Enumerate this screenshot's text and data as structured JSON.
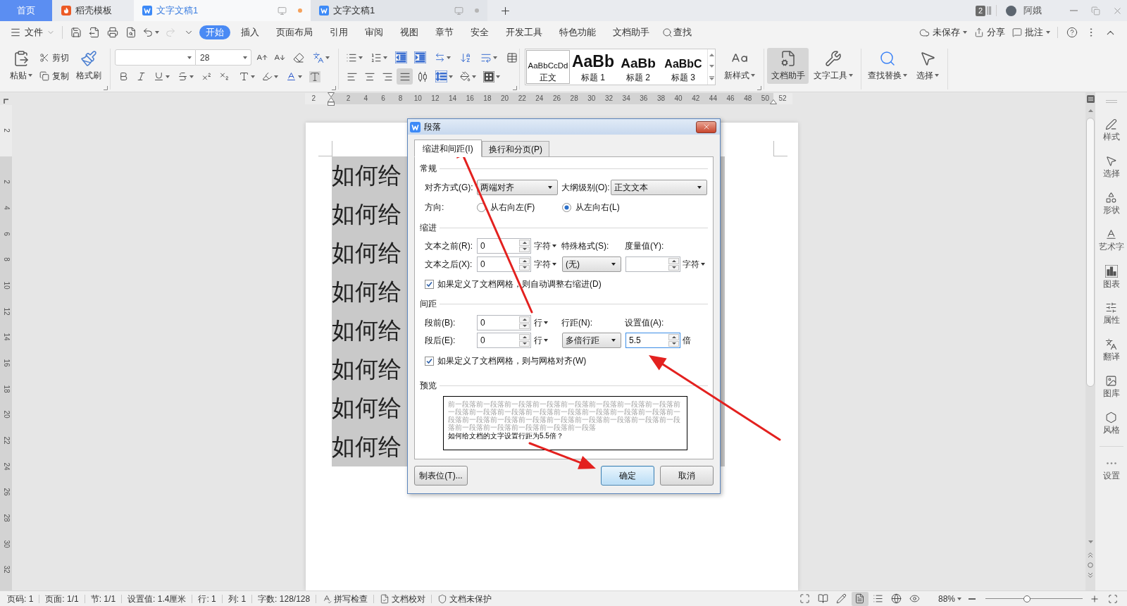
{
  "tab_bar": {
    "tabs": [
      {
        "label": "首页",
        "kind": "home",
        "selected": false
      },
      {
        "label": "稻壳模板",
        "kind": "template",
        "selected": false
      },
      {
        "label": "文字文稿1",
        "kind": "document",
        "selected": true
      },
      {
        "label": "文字文稿1",
        "kind": "document",
        "selected": false
      }
    ],
    "badge": "2",
    "user_name": "阿娥"
  },
  "menu_bar": {
    "file_menu": "文件",
    "quick_access": [
      {
        "kind": "save",
        "disabled": false
      },
      {
        "kind": "export",
        "disabled": false
      },
      {
        "kind": "print",
        "disabled": false
      },
      {
        "kind": "preview",
        "disabled": false
      },
      {
        "kind": "undo",
        "disabled": false
      },
      {
        "kind": "redo",
        "disabled": true
      },
      {
        "kind": "customize",
        "disabled": false
      }
    ],
    "tabs": [
      {
        "label": "开始",
        "selected": true
      },
      {
        "label": "插入",
        "selected": false
      },
      {
        "label": "页面布局",
        "selected": false
      },
      {
        "label": "引用",
        "selected": false
      },
      {
        "label": "审阅",
        "selected": false
      },
      {
        "label": "视图",
        "selected": false
      },
      {
        "label": "章节",
        "selected": false
      },
      {
        "label": "安全",
        "selected": false
      },
      {
        "label": "开发工具",
        "selected": false
      },
      {
        "label": "特色功能",
        "selected": false
      },
      {
        "label": "文档助手",
        "selected": false
      }
    ],
    "search": "查找",
    "actions": [
      {
        "label": "未保存",
        "kind": "cloud"
      },
      {
        "label": "分享",
        "kind": "share"
      },
      {
        "label": "批注",
        "kind": "comment"
      }
    ]
  },
  "toolbar": {
    "clipboard": {
      "paste": "粘贴",
      "cut": "剪切",
      "copy": "复制",
      "format_painter": "格式刷"
    },
    "font_size": "28",
    "alignment": [
      {
        "kind": "left",
        "selected": false
      },
      {
        "kind": "center",
        "selected": false
      },
      {
        "kind": "right",
        "selected": false
      },
      {
        "kind": "justify",
        "selected": true
      },
      {
        "kind": "distributed",
        "selected": false
      }
    ],
    "styles": [
      {
        "sample": "AaBbCcDd",
        "label": "正文",
        "kind": "body",
        "selected": true
      },
      {
        "sample": "AaBb",
        "label": "标题 1",
        "kind": "heading1",
        "selected": false
      },
      {
        "sample": "AaBb",
        "label": "标题 2",
        "kind": "heading2",
        "selected": false
      },
      {
        "sample": "AaBbC",
        "label": "标题 3",
        "kind": "heading3",
        "selected": false
      }
    ],
    "new_style": "新样式",
    "tools": [
      {
        "label": "文档助手",
        "kind": "assistant",
        "selected": true
      },
      {
        "label": "文字工具",
        "kind": "text_tools",
        "selected": false
      }
    ],
    "find": [
      {
        "label": "查找替换",
        "kind": "find"
      },
      {
        "label": "选择",
        "kind": "select"
      }
    ]
  },
  "horizontal_ruler": {
    "left_label": "2",
    "labels": [
      "2",
      "4",
      "6",
      "8",
      "10",
      "12",
      "14",
      "16",
      "18",
      "20",
      "22",
      "24",
      "26",
      "28",
      "30",
      "32",
      "34",
      "36",
      "38",
      "40",
      "42",
      "44",
      "46",
      "48",
      "50",
      "52"
    ]
  },
  "vertical_ruler": {
    "top_label": "2",
    "labels": [
      "2",
      "4",
      "6",
      "8",
      "10",
      "12",
      "14",
      "16",
      "18",
      "20",
      "22",
      "24",
      "26",
      "28",
      "30",
      "32"
    ]
  },
  "document": {
    "lines": [
      "如何给",
      "如何给",
      "如何给",
      "如何给",
      "如何给",
      "如何给",
      "如何给",
      "如何给"
    ]
  },
  "dialog": {
    "title": "段落",
    "tabs": [
      {
        "label": "缩进和间距(I)",
        "selected": true
      },
      {
        "label": "换行和分页(P)",
        "selected": false
      }
    ],
    "general": {
      "heading": "常规",
      "alignment": {
        "label": "对齐方式(G):",
        "value": "两端对齐"
      },
      "outline_level": {
        "label": "大纲级别(O):",
        "value": "正文文本"
      },
      "direction": {
        "label": "方向:",
        "options": [
          {
            "label": "从右向左(F)",
            "selected": false
          },
          {
            "label": "从左向右(L)",
            "selected": true
          }
        ]
      }
    },
    "indent": {
      "heading": "缩进",
      "before": {
        "label": "文本之前(R):",
        "value": "0",
        "unit": "字符"
      },
      "after": {
        "label": "文本之后(X):",
        "value": "0",
        "unit": "字符"
      },
      "special": {
        "label": "特殊格式(S):",
        "value": "(无)"
      },
      "measure": {
        "label": "度量值(Y):",
        "unit": "字符"
      },
      "auto_adjust": {
        "label": "如果定义了文档网格，则自动调整右缩进(D)",
        "checked": true
      }
    },
    "spacing": {
      "heading": "间距",
      "before": {
        "label": "段前(B):",
        "value": "0",
        "unit": "行"
      },
      "after": {
        "label": "段后(E):",
        "value": "0",
        "unit": "行"
      },
      "line_spacing": {
        "label": "行距(N):",
        "value": "多倍行距"
      },
      "set_value": {
        "label": "设置值(A):",
        "value": "5.5",
        "suffix": "倍",
        "focused": true
      },
      "snap_to_grid": {
        "label": "如果定义了文档网格，则与网格对齐(W)",
        "checked": true
      }
    },
    "preview": {
      "heading": "预览",
      "preceding_text": "前一段落前一段落前一段落前一段落前一段落前一段落前一段落前一段落前一段落前一段落前一段落前一段落前一段落前一段落前一段落前一段落前一段落前一段落前一段落前一段落前一段落前一段落前一段落前一段落前一段落前一段落前一段落前一段落前一段落前一段落",
      "sample_text": "如何给文档的文字设置行距为5.5倍？"
    },
    "buttons": [
      {
        "label": "制表位(T)...",
        "kind": "secondary"
      },
      {
        "label": "确定",
        "kind": "primary"
      },
      {
        "label": "取消",
        "kind": "secondary"
      }
    ]
  },
  "right_sidebar": {
    "items": [
      {
        "label": "样式",
        "kind": "style"
      },
      {
        "label": "选择",
        "kind": "select"
      },
      {
        "label": "形状",
        "kind": "shape"
      },
      {
        "label": "艺术字",
        "kind": "word_art"
      },
      {
        "label": "图表",
        "kind": "chart"
      },
      {
        "label": "属性",
        "kind": "properties"
      },
      {
        "label": "翻译",
        "kind": "translate"
      },
      {
        "label": "图库",
        "kind": "gallery"
      },
      {
        "label": "风格",
        "kind": "theme"
      },
      {
        "label": "设置",
        "kind": "settings"
      }
    ]
  },
  "status_bar": {
    "fields": [
      "页码: 1",
      "页面: 1/1",
      "节: 1/1",
      "设置值: 1.4厘米",
      "行: 1",
      "列: 1",
      "字数: 128/128"
    ],
    "tools": [
      {
        "label": "拼写检查",
        "kind": "spell_check"
      },
      {
        "label": "文档校对",
        "kind": "proofread"
      },
      {
        "label": "文档未保护",
        "kind": "protection"
      }
    ],
    "view_modes": [
      {
        "kind": "fit",
        "selected": false
      },
      {
        "kind": "reading",
        "selected": false
      },
      {
        "kind": "edit",
        "selected": false
      },
      {
        "kind": "page",
        "selected": true
      },
      {
        "kind": "outline",
        "selected": false
      },
      {
        "kind": "web",
        "selected": false
      },
      {
        "kind": "eye_care",
        "selected": false
      }
    ],
    "zoom": {
      "value": "88%",
      "level": 0.43
    }
  }
}
